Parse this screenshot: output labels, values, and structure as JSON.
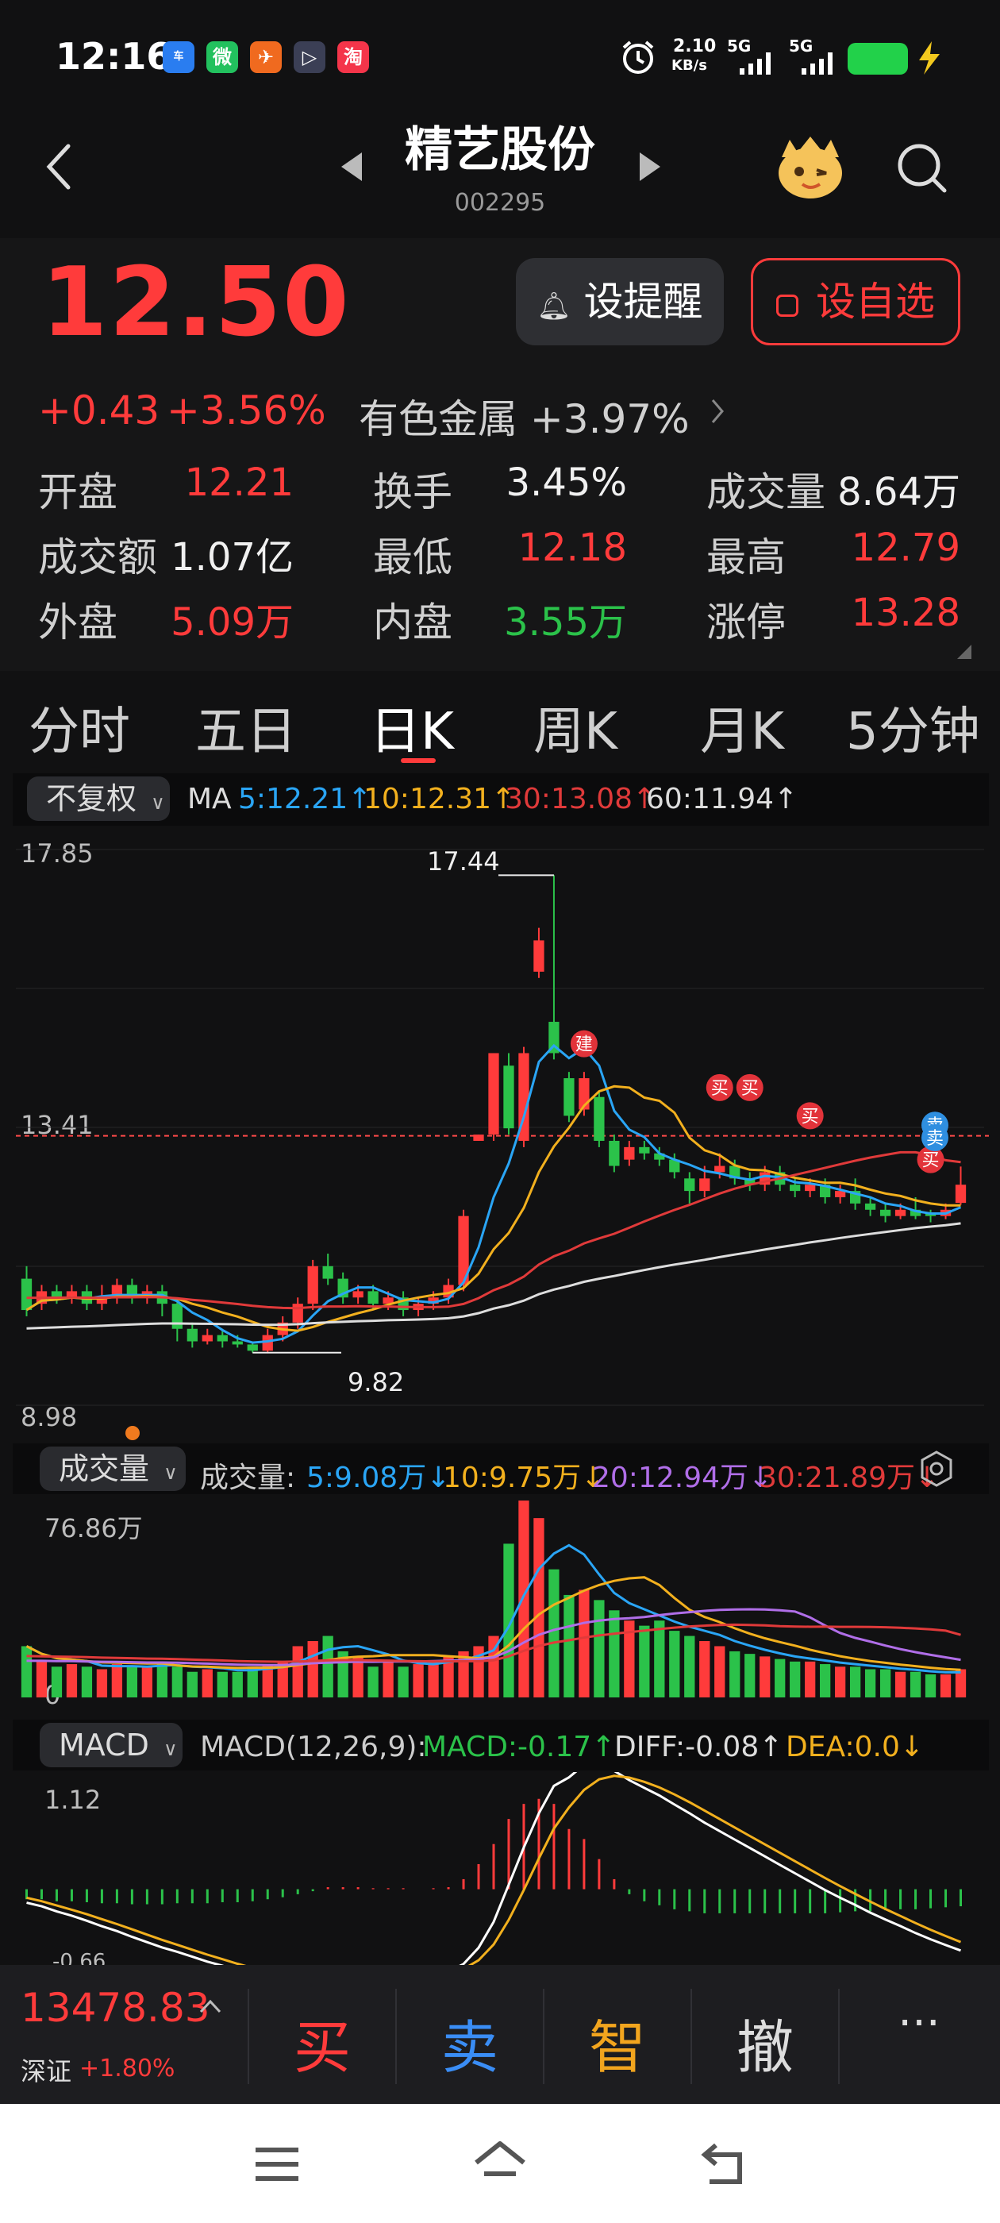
{
  "status_bar": {
    "time": "12:16",
    "net_speed": "2.10",
    "net_unit": "KB/s",
    "network1": "5G",
    "network2": "5G",
    "apps": [
      "汽车之家",
      "微信",
      "飞书",
      "播放器",
      "淘"
    ]
  },
  "header": {
    "stock_name": "精艺股份",
    "stock_code": "002295"
  },
  "quote": {
    "price": "12.50",
    "change": "+0.43",
    "change_pct": "+3.56%",
    "sector": "有色金属 +3.97%",
    "remind_label": "设提醒",
    "fav_label": "设自选",
    "rows": [
      [
        {
          "label": "开盘",
          "value": "12.21",
          "tone": "red"
        },
        {
          "label": "换手",
          "value": "3.45%",
          "tone": "white"
        },
        {
          "label": "成交量",
          "value": "8.64万",
          "tone": "white"
        }
      ],
      [
        {
          "label": "成交额",
          "value": "1.07亿",
          "tone": "white"
        },
        {
          "label": "最低",
          "value": "12.18",
          "tone": "red"
        },
        {
          "label": "最高",
          "value": "12.79",
          "tone": "red"
        }
      ],
      [
        {
          "label": "外盘",
          "value": "5.09万",
          "tone": "red"
        },
        {
          "label": "内盘",
          "value": "3.55万",
          "tone": "green"
        },
        {
          "label": "涨停",
          "value": "13.28",
          "tone": "red"
        }
      ]
    ]
  },
  "tabs": [
    "分时",
    "五日",
    "日K",
    "周K",
    "月K",
    "5分钟"
  ],
  "active_tab": "日K",
  "kline": {
    "adjust_label": "不复权",
    "ma_title": "MA",
    "ma5": "5:12.21↑",
    "ma10": "10:12.31↑",
    "ma30": "30:13.08↑",
    "ma60": "60:11.94↑",
    "y_top": "17.85",
    "y_mid": "13.41",
    "y_bottom": "8.98",
    "high_marker": "17.44",
    "low_marker": "9.82",
    "signals": [
      "建",
      "买",
      "买",
      "买",
      "买",
      "卖",
      "卖"
    ]
  },
  "volume": {
    "label": "成交量",
    "title": "成交量:",
    "v5": "5:9.08万↓",
    "v10": "10:9.75万↓",
    "v20": "20:12.94万↓",
    "v30": "30:21.89万↓",
    "y_top": "76.86万",
    "y_bottom": "0"
  },
  "macd": {
    "label": "MACD",
    "params": "MACD(12,26,9):",
    "macd_val": "MACD:-0.17↑",
    "diff_val": "DIFF:-0.08↑",
    "dea_val": "DEA:0.0↓",
    "y_top": "1.12",
    "y_bottom": "-0.66"
  },
  "chart_data": {
    "type": "candlestick",
    "price_range": [
      8.98,
      17.85
    ],
    "candles": [
      {
        "o": 11.0,
        "c": 10.5,
        "h": 11.2,
        "l": 10.4
      },
      {
        "o": 10.6,
        "c": 10.8,
        "h": 10.9,
        "l": 10.5
      },
      {
        "o": 10.8,
        "c": 10.7,
        "h": 10.9,
        "l": 10.6
      },
      {
        "o": 10.7,
        "c": 10.8,
        "h": 10.9,
        "l": 10.6
      },
      {
        "o": 10.8,
        "c": 10.6,
        "h": 10.9,
        "l": 10.5
      },
      {
        "o": 10.6,
        "c": 10.7,
        "h": 10.9,
        "l": 10.5
      },
      {
        "o": 10.7,
        "c": 10.9,
        "h": 11.0,
        "l": 10.6
      },
      {
        "o": 10.9,
        "c": 10.7,
        "h": 11.0,
        "l": 10.6
      },
      {
        "o": 10.7,
        "c": 10.8,
        "h": 10.9,
        "l": 10.6
      },
      {
        "o": 10.8,
        "c": 10.6,
        "h": 10.9,
        "l": 10.4
      },
      {
        "o": 10.6,
        "c": 10.2,
        "h": 10.7,
        "l": 10.0
      },
      {
        "o": 10.2,
        "c": 10.0,
        "h": 10.3,
        "l": 9.9
      },
      {
        "o": 10.0,
        "c": 10.1,
        "h": 10.2,
        "l": 9.95
      },
      {
        "o": 10.1,
        "c": 10.0,
        "h": 10.2,
        "l": 9.9
      },
      {
        "o": 10.0,
        "c": 9.95,
        "h": 10.1,
        "l": 9.9
      },
      {
        "o": 9.95,
        "c": 9.85,
        "h": 10.0,
        "l": 9.82
      },
      {
        "o": 9.85,
        "c": 10.1,
        "h": 10.2,
        "l": 9.82
      },
      {
        "o": 10.1,
        "c": 10.3,
        "h": 10.4,
        "l": 10.0
      },
      {
        "o": 10.3,
        "c": 10.6,
        "h": 10.7,
        "l": 10.2
      },
      {
        "o": 10.6,
        "c": 11.2,
        "h": 11.3,
        "l": 10.5
      },
      {
        "o": 11.2,
        "c": 11.0,
        "h": 11.4,
        "l": 10.9
      },
      {
        "o": 11.0,
        "c": 10.7,
        "h": 11.1,
        "l": 10.6
      },
      {
        "o": 10.7,
        "c": 10.8,
        "h": 10.9,
        "l": 10.6
      },
      {
        "o": 10.8,
        "c": 10.6,
        "h": 10.9,
        "l": 10.5
      },
      {
        "o": 10.6,
        "c": 10.7,
        "h": 10.8,
        "l": 10.5
      },
      {
        "o": 10.7,
        "c": 10.5,
        "h": 10.8,
        "l": 10.4
      },
      {
        "o": 10.5,
        "c": 10.6,
        "h": 10.7,
        "l": 10.4
      },
      {
        "o": 10.6,
        "c": 10.7,
        "h": 10.8,
        "l": 10.5
      },
      {
        "o": 10.7,
        "c": 10.9,
        "h": 11.0,
        "l": 10.6
      },
      {
        "o": 10.9,
        "c": 12.0,
        "h": 12.1,
        "l": 10.8
      },
      {
        "o": 13.2,
        "c": 13.3,
        "h": 13.3,
        "l": 13.2
      },
      {
        "o": 13.3,
        "c": 14.6,
        "h": 14.6,
        "l": 13.2
      },
      {
        "o": 14.4,
        "c": 13.4,
        "h": 14.6,
        "l": 13.3
      },
      {
        "o": 13.2,
        "c": 14.6,
        "h": 14.7,
        "l": 13.1
      },
      {
        "o": 15.9,
        "c": 16.4,
        "h": 16.6,
        "l": 15.8
      },
      {
        "o": 15.1,
        "c": 14.6,
        "h": 17.44,
        "l": 14.5
      },
      {
        "o": 14.2,
        "c": 13.6,
        "h": 14.3,
        "l": 13.5
      },
      {
        "o": 13.7,
        "c": 14.2,
        "h": 14.3,
        "l": 13.6
      },
      {
        "o": 13.9,
        "c": 13.2,
        "h": 14.0,
        "l": 13.1
      },
      {
        "o": 13.2,
        "c": 12.8,
        "h": 13.3,
        "l": 12.7
      },
      {
        "o": 12.9,
        "c": 13.1,
        "h": 13.2,
        "l": 12.8
      },
      {
        "o": 13.1,
        "c": 13.0,
        "h": 13.2,
        "l": 12.9
      },
      {
        "o": 13.0,
        "c": 12.9,
        "h": 13.1,
        "l": 12.8
      },
      {
        "o": 12.9,
        "c": 12.7,
        "h": 13.0,
        "l": 12.6
      },
      {
        "o": 12.6,
        "c": 12.4,
        "h": 12.7,
        "l": 12.2
      },
      {
        "o": 12.4,
        "c": 12.6,
        "h": 12.8,
        "l": 12.3
      },
      {
        "o": 12.7,
        "c": 12.8,
        "h": 13.0,
        "l": 12.6
      },
      {
        "o": 12.8,
        "c": 12.6,
        "h": 12.9,
        "l": 12.5
      },
      {
        "o": 12.6,
        "c": 12.5,
        "h": 12.7,
        "l": 12.4
      },
      {
        "o": 12.5,
        "c": 12.7,
        "h": 12.8,
        "l": 12.4
      },
      {
        "o": 12.7,
        "c": 12.5,
        "h": 12.8,
        "l": 12.4
      },
      {
        "o": 12.5,
        "c": 12.4,
        "h": 12.6,
        "l": 12.3
      },
      {
        "o": 12.4,
        "c": 12.5,
        "h": 12.6,
        "l": 12.3
      },
      {
        "o": 12.5,
        "c": 12.3,
        "h": 12.6,
        "l": 12.2
      },
      {
        "o": 12.3,
        "c": 12.4,
        "h": 12.5,
        "l": 12.2
      },
      {
        "o": 12.4,
        "c": 12.2,
        "h": 12.6,
        "l": 12.1
      },
      {
        "o": 12.2,
        "c": 12.1,
        "h": 12.3,
        "l": 12.0
      },
      {
        "o": 12.1,
        "c": 12.0,
        "h": 12.2,
        "l": 11.9
      },
      {
        "o": 12.0,
        "c": 12.1,
        "h": 12.2,
        "l": 11.95
      },
      {
        "o": 12.1,
        "c": 12.0,
        "h": 12.3,
        "l": 11.95
      },
      {
        "o": 12.05,
        "c": 12.0,
        "h": 12.1,
        "l": 11.9
      },
      {
        "o": 12.0,
        "c": 12.1,
        "h": 12.2,
        "l": 11.95
      },
      {
        "o": 12.21,
        "c": 12.5,
        "h": 12.79,
        "l": 12.18
      }
    ],
    "volumes_wan": [
      20,
      14,
      12,
      13,
      12,
      11,
      13,
      12,
      12,
      14,
      12,
      10,
      11,
      10,
      10,
      12,
      13,
      14,
      20,
      22,
      24,
      18,
      16,
      12,
      14,
      12,
      13,
      14,
      16,
      18,
      20,
      24,
      60,
      76.86,
      70,
      50,
      40,
      42,
      38,
      34,
      30,
      28,
      30,
      26,
      24,
      22,
      20,
      18,
      17,
      16,
      15,
      14,
      14,
      13,
      12,
      12,
      11,
      11,
      10,
      10,
      9,
      9,
      11
    ],
    "macd_range": [
      -0.66,
      1.12
    ],
    "macd_hist": [
      -0.1,
      -0.1,
      -0.12,
      -0.12,
      -0.13,
      -0.14,
      -0.14,
      -0.15,
      -0.15,
      -0.15,
      -0.14,
      -0.14,
      -0.14,
      -0.13,
      -0.13,
      -0.12,
      -0.1,
      -0.08,
      -0.05,
      -0.02,
      0.02,
      0.02,
      0.02,
      0.01,
      0.01,
      0.01,
      0.0,
      0.01,
      0.02,
      0.1,
      0.25,
      0.45,
      0.7,
      0.85,
      0.9,
      0.85,
      0.6,
      0.5,
      0.3,
      0.1,
      -0.05,
      -0.12,
      -0.16,
      -0.2,
      -0.22,
      -0.24,
      -0.24,
      -0.24,
      -0.24,
      -0.24,
      -0.24,
      -0.24,
      -0.24,
      -0.24,
      -0.23,
      -0.22,
      -0.22,
      -0.21,
      -0.2,
      -0.2,
      -0.19,
      -0.18,
      -0.17
    ]
  },
  "bottom_bar": {
    "index_value": "13478.83",
    "index_name": "深证",
    "index_change": "+1.80%",
    "buy": "买",
    "sell": "卖",
    "smart": "智",
    "cancel": "撤",
    "more": "···"
  },
  "colors": {
    "up": "#ff3b3b",
    "down": "#2bc24a",
    "ma5": "#2aa5f5",
    "ma10": "#f2b01e",
    "ma30": "#e03a3a",
    "ma60": "#dddddd",
    "vol20": "#b06ee8"
  }
}
